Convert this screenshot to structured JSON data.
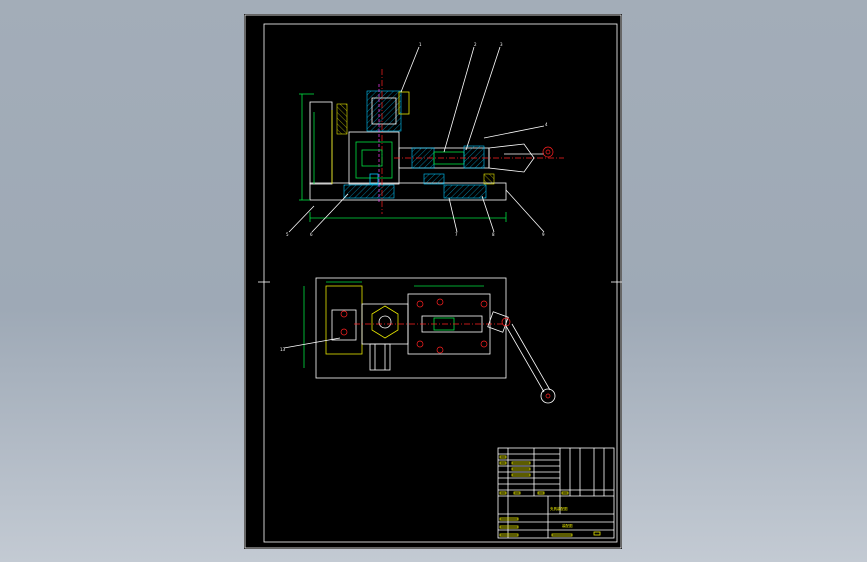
{
  "drawing": {
    "section_view": {
      "balloons": [
        "1",
        "2",
        "3",
        "4",
        "5",
        "6",
        "7",
        "8",
        "9",
        "10",
        "11",
        "12"
      ]
    },
    "plan_view": {
      "balloons": [
        "13"
      ]
    },
    "title_block": {
      "drawing_title": "夹具装配图",
      "drawing_title_sub": "装配图"
    }
  },
  "colors": {
    "background": "#9ea9b6",
    "sheet": "#000000",
    "line_white": "#ffffff",
    "line_yellow": "#e6e600",
    "line_green": "#00e040",
    "line_cyan": "#00c8ff",
    "line_red": "#ff2020",
    "line_magenta": "#ff40ff"
  }
}
